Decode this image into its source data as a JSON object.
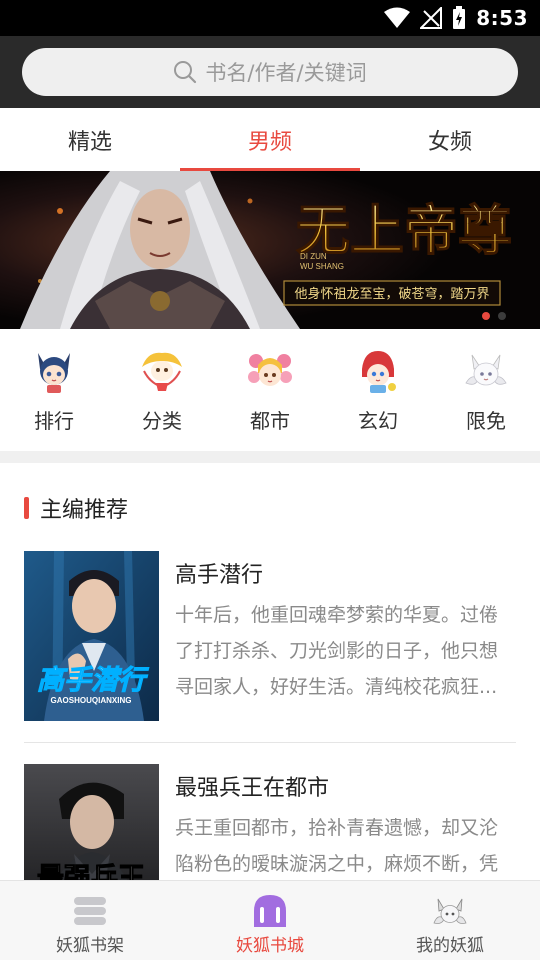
{
  "status_bar": {
    "time": "8:53"
  },
  "search": {
    "placeholder": "书名/作者/关键词"
  },
  "tabs": [
    {
      "label": "精选"
    },
    {
      "label": "男频",
      "active": true
    },
    {
      "label": "女频"
    }
  ],
  "banner": {
    "title": "无上帝尊",
    "pinyin_line1": "DI ZUN",
    "pinyin_line2": "WU SHANG",
    "slogan": "他身怀祖龙至宝，破苍穹，踏万界",
    "slide_count": 2,
    "active_slide": 1
  },
  "quick_nav": [
    {
      "label": "排行",
      "icon": "fox-mascot-rank-icon"
    },
    {
      "label": "分类",
      "icon": "fox-mascot-category-icon"
    },
    {
      "label": "都市",
      "icon": "fox-mascot-city-icon"
    },
    {
      "label": "玄幻",
      "icon": "fox-mascot-fantasy-icon"
    },
    {
      "label": "限免",
      "icon": "fox-mascot-free-icon"
    }
  ],
  "section": {
    "title": "主编推荐"
  },
  "books": [
    {
      "title": "高手潜行",
      "cover_title": "高手潜行",
      "cover_pinyin": "GAOSHOUQIANXING",
      "description": "十年后，他重回魂牵梦萦的华夏。过倦了打打杀杀、刀光剑影的日子，他只想寻回家人，好好生活。清纯校花疯狂..."
    },
    {
      "title": "最强兵王在都市",
      "cover_title": "最强兵王",
      "description": "兵王重回都市，拾补青春遗憾，却又沦陷粉色的暧昧漩涡之中，麻烦不断，凭"
    }
  ],
  "bottom_nav": [
    {
      "label": "妖狐书架",
      "icon": "bookshelf-icon"
    },
    {
      "label": "妖狐书城",
      "icon": "bookstore-icon",
      "active": true
    },
    {
      "label": "我的妖狐",
      "icon": "profile-fox-icon"
    }
  ],
  "colors": {
    "accent": "#e8493f",
    "header_bg": "#2a2a2a",
    "banner_gold": "#f0c040"
  }
}
